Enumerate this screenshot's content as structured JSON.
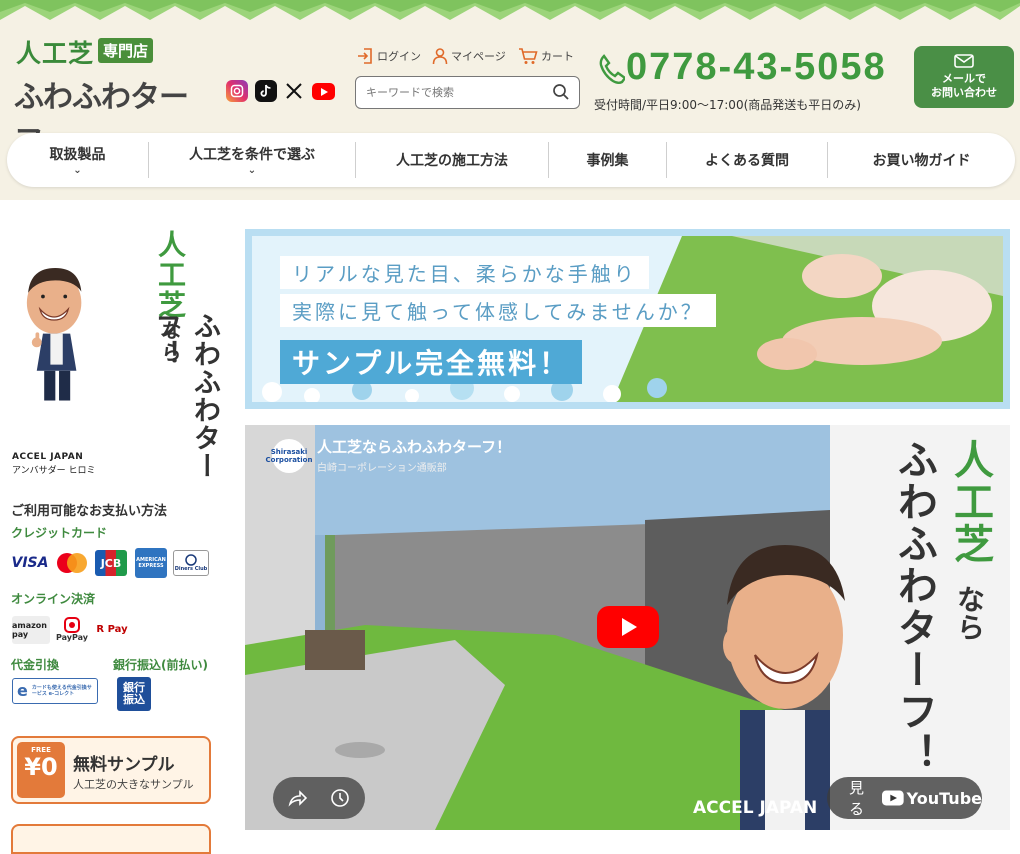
{
  "logo": {
    "line1": "人工芝",
    "badge": "専門店",
    "line2": "ふわふわターフ"
  },
  "social": [
    {
      "name": "instagram-icon"
    },
    {
      "name": "tiktok-icon"
    },
    {
      "name": "x-icon"
    },
    {
      "name": "youtube-icon"
    }
  ],
  "utility": {
    "login": "ログイン",
    "mypage": "マイページ",
    "cart": "カート"
  },
  "search": {
    "placeholder": "キーワードで検索"
  },
  "contact": {
    "phone": "0778-43-5058",
    "hours": "受付時間/平日9:00〜17:00(商品発送も平日のみ)",
    "mail_line1": "メールで",
    "mail_line2": "お問い合わせ"
  },
  "nav": [
    {
      "label": "取扱製品"
    },
    {
      "label": "人工芝を条件で選ぶ"
    },
    {
      "label": "人工芝の施工方法"
    },
    {
      "label": "事例集"
    },
    {
      "label": "よくある質問"
    },
    {
      "label": "お買い物ガイド"
    }
  ],
  "sidebar": {
    "slogan_1": "人工芝",
    "slogan_2": "なら",
    "slogan_3": "ふわふわターフ！",
    "ambassador_brand": "ACCEL JAPAN",
    "ambassador_name": "アンバサダー ヒロミ",
    "payment_title": "ご利用可能なお支払い方法",
    "credit_label": "クレジットカード",
    "cards": [
      "VISA",
      "JCB",
      "AMERICAN EXPRESS",
      "Diners Club"
    ],
    "online_label": "オンライン決済",
    "online": [
      "amazon pay",
      "PayPay",
      "R Pay"
    ],
    "cod_label": "代金引換",
    "bank_label": "銀行振込(前払い)",
    "ecollect_text": "カードも使える代金引換サービス e-コレクト",
    "bank_badge": "銀行振込",
    "free_price": "¥0",
    "free_tag": "FREE",
    "free_title": "無料サンプル",
    "free_sub": "人工芝の大きなサンプル"
  },
  "banner": {
    "line1": "リアルな見た目、柔らかな手触り",
    "line2": "実際に見て触って体感してみませんか？",
    "line3": "サンプル完全無料！"
  },
  "video": {
    "title": "人工芝ならふわふわターフ！",
    "channel": "白崎コーポレーション通販部",
    "channel_logo": "Shirasaki Corporation",
    "slogan_1": "人工芝",
    "slogan_2": "なら",
    "slogan_3": "ふわふわターフ！",
    "watch_label": "見る",
    "youtube_label": "YouTube",
    "brand": "ACCEL JAPAN"
  },
  "colors": {
    "brand_green": "#4a8f3a",
    "phone_green": "#3f9a3f",
    "accent_orange": "#e06a2a",
    "banner_blue": "#4fa9d6",
    "header_bg": "#f5f1e4"
  }
}
